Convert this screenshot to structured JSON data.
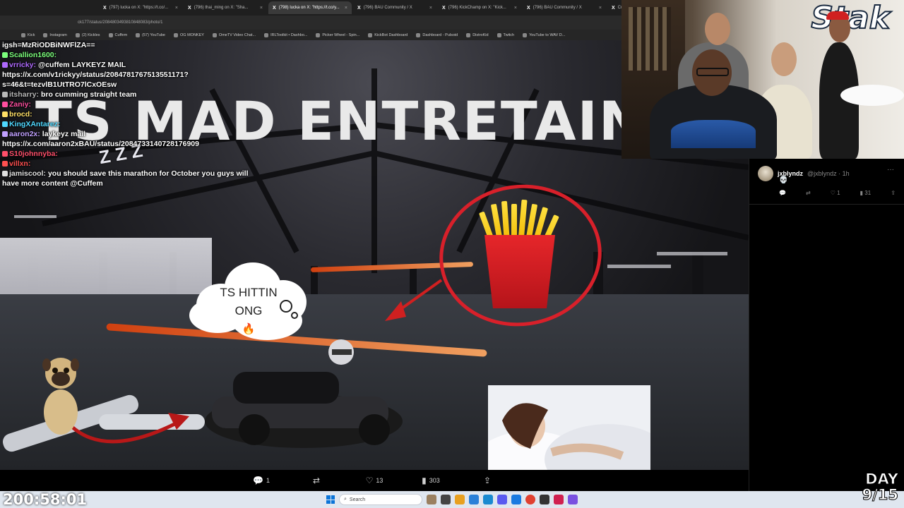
{
  "browser": {
    "tabs": [
      {
        "label": "(797) lucka on X: \"https://t.co/...",
        "active": false
      },
      {
        "label": "(796) thai_ming on X: \"Sha...",
        "active": false
      },
      {
        "label": "(798) lucka on X: \"https://t.co/y...",
        "active": true
      },
      {
        "label": "(796) BAU Community / X",
        "active": false
      },
      {
        "label": "(796) KickChamp on X: \"Kick...",
        "active": false
      },
      {
        "label": "(796) BAU Community / X",
        "active": false
      },
      {
        "label": "Cuff",
        "active": false
      }
    ],
    "url": "ck177/status/2084803493810848083/photo/1",
    "bookmarks": [
      "Kick",
      "Instagram",
      "(2) Kickles",
      "Cuffem",
      "(57) YouTube",
      "OG MONKEY",
      "OmeTV Video Chat...",
      "IRLToolkit • Dashbo...",
      "Picker Wheel - Spin...",
      "KickBot Dashboard",
      "Dashboard - Pulsoid",
      "DistroKid",
      "Twitch",
      "YouTube to WAV D..."
    ]
  },
  "headline": "TS MAD ENTRETAINI",
  "chat": [
    {
      "user": "",
      "message": "igsh=MzRiODBiNWFlZA==",
      "color": "#ffffff"
    },
    {
      "user": "Scallion1600:",
      "message": "",
      "color": "#7cff7c"
    },
    {
      "user": "vrricky:",
      "message": "@cuffem LAYKEYZ MAIL",
      "color": "#b06aff"
    },
    {
      "user": "",
      "message": "https://x.com/v1rickyy/status/2084781767513551171?",
      "color": "#ffffff"
    },
    {
      "user": "",
      "message": "s=46&t=tezvlB1UtTRO7lCxOEsw",
      "color": "#ffffff"
    },
    {
      "user": "itsharry:",
      "message": "bro cumming straight team",
      "color": "#b8b8b8"
    },
    {
      "user": "Zaniy:",
      "message": "",
      "color": "#ff4fa0"
    },
    {
      "user": "brocd:",
      "message": "",
      "color": "#ffe066"
    },
    {
      "user": "KingXAntarez:",
      "message": "",
      "color": "#4fd8ff"
    },
    {
      "user": "aaron2x:",
      "message": "laykeyz mail",
      "color": "#c0a0ff"
    },
    {
      "user": "",
      "message": "https://x.com/aaron2xBAU/status/2084733140728176909",
      "color": "#ffffff"
    },
    {
      "user": "S10johnnyba:",
      "message": "",
      "color": "#ff4f6a"
    },
    {
      "user": "villxn:",
      "message": "",
      "color": "#ff5050"
    },
    {
      "user": "jamiscool:",
      "message": "you should save this marathon for October you guys will",
      "color": "#e0e0e0"
    },
    {
      "user": "",
      "message": "have more content @Cuffem",
      "color": "#ffffff"
    }
  ],
  "thought_cloud": {
    "line1": "TS HITTIN",
    "line2": "ONG",
    "emoji": "🔥"
  },
  "sleep_symbol": "Z Z Z",
  "tweet_bar": {
    "replies": "1",
    "retweets": "",
    "likes": "13",
    "views": "303"
  },
  "side_tweet": {
    "name": "jxblyndz",
    "handle": "@jxblyndz · 1h",
    "body": "💀",
    "replies": "",
    "retweets": "",
    "likes": "1",
    "views": "31"
  },
  "webcam_logo": "Stak",
  "timer": "200:58:01",
  "day_counter": {
    "line1": "DAY",
    "line2": "9/15"
  },
  "taskbar": {
    "search_placeholder": "Search"
  },
  "colors": {
    "accent_red": "#d8202a",
    "fries_yellow": "#ffd21f",
    "taskbar": "#dfe6ef"
  }
}
